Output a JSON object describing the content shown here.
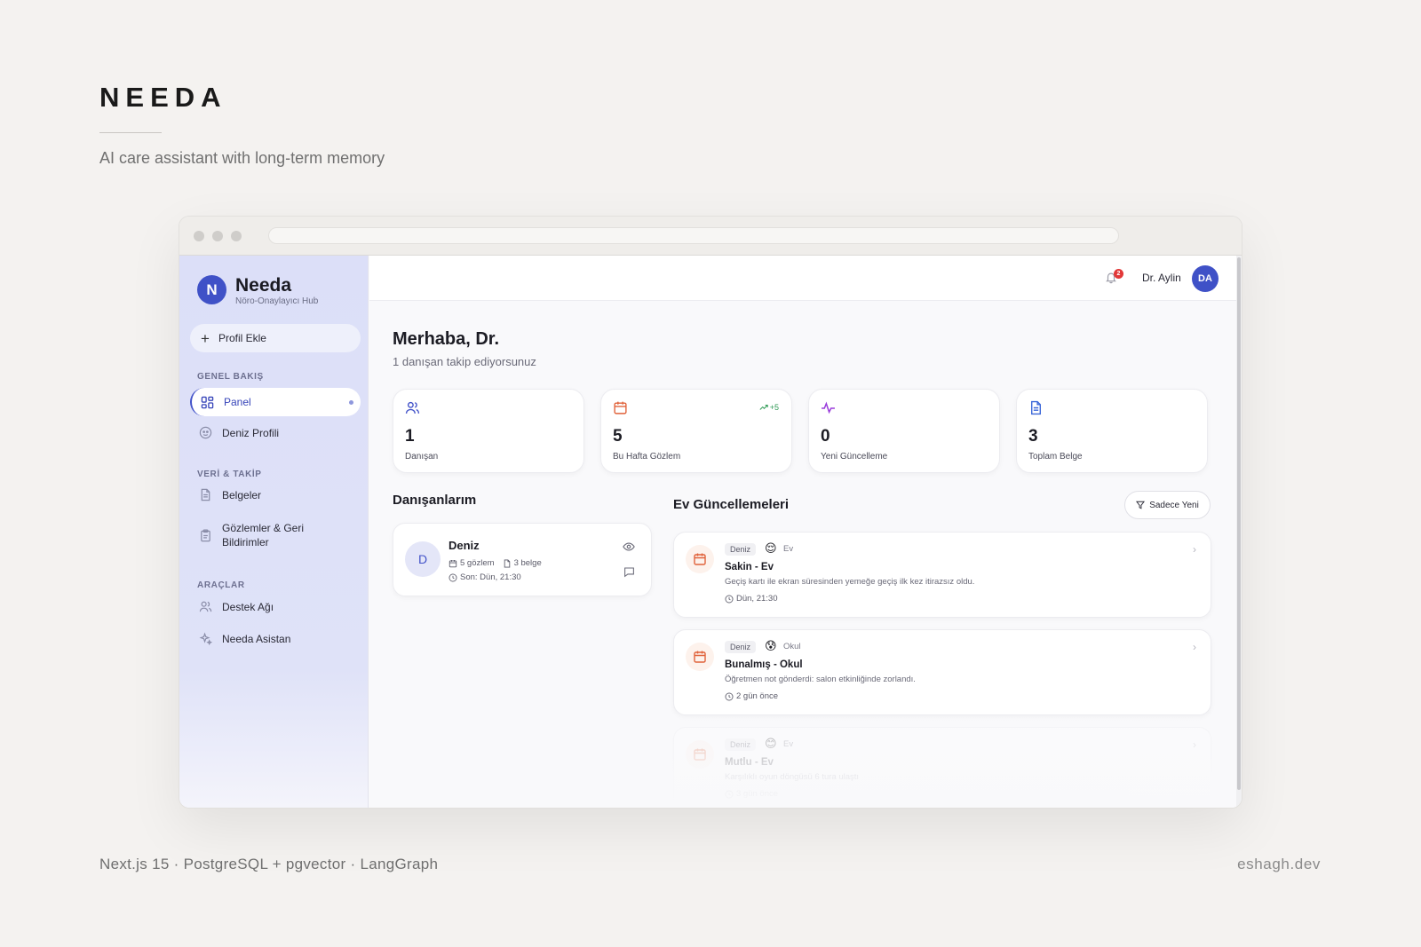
{
  "showcase": {
    "title": "NEEDA",
    "subtitle": "AI care assistant with long-term memory",
    "stack": "Next.js 15 · PostgreSQL + pgvector · LangGraph",
    "site": "eshagh.dev"
  },
  "sidebar": {
    "logo_letter": "N",
    "app_name": "Needa",
    "tagline": "Nöro-Onaylayıcı Hub",
    "add_profile": "Profil Ekle",
    "sections": {
      "overview": "GENEL BAKIŞ",
      "data": "VERİ & TAKİP",
      "tools": "ARAÇLAR"
    },
    "items": {
      "panel": "Panel",
      "profile": "Deniz Profili",
      "documents": "Belgeler",
      "observations": "Gözlemler & Geri Bildirimler",
      "support": "Destek Ağı",
      "assistant": "Needa Asistan"
    }
  },
  "topbar": {
    "notification_count": "2",
    "user_name": "Dr. Aylin",
    "user_initials": "DA"
  },
  "main": {
    "greeting": "Merhaba, Dr.",
    "greeting_sub": "1 danışan takip ediyorsunuz",
    "stats": [
      {
        "value": "1",
        "label": "Danışan",
        "icon": "users-icon",
        "color": "#4353c9"
      },
      {
        "value": "5",
        "label": "Bu Hafta Gözlem",
        "icon": "calendar-icon",
        "color": "#e0623a",
        "trend": "+5"
      },
      {
        "value": "0",
        "label": "Yeni Güncelleme",
        "icon": "activity-icon",
        "color": "#9a3ddb"
      },
      {
        "value": "3",
        "label": "Toplam Belge",
        "icon": "document-icon",
        "color": "#3a66d8"
      }
    ],
    "clients_title": "Danışanlarım",
    "client": {
      "initial": "D",
      "name": "Deniz",
      "observations": "5 gözlem",
      "documents": "3 belge",
      "last": "Son: Dün, 21:30"
    },
    "updates_title": "Ev Güncellemeleri",
    "filter_label": "Sadece Yeni",
    "updates": [
      {
        "client": "Deniz",
        "emoji": "😌",
        "place": "Ev",
        "title": "Sakin - Ev",
        "desc": "Geçiş kartı ile ekran süresinden yemeğe geçiş ilk kez itirazsız oldu.",
        "time": "Dün, 21:30"
      },
      {
        "client": "Deniz",
        "emoji": "😰",
        "place": "Okul",
        "title": "Bunalmış - Okul",
        "desc": "Öğretmen not gönderdi: salon etkinliğinde zorlandı.",
        "time": "2 gün önce"
      },
      {
        "client": "Deniz",
        "emoji": "😊",
        "place": "Ev",
        "title": "Mutlu - Ev",
        "desc": "Karşılıklı oyun döngüsü 6 tura ulaştı",
        "time": "3 gün önce"
      }
    ]
  },
  "colors": {
    "accent": "#3f51c7",
    "update_icon": "#e0623a",
    "trend": "#2f9a55",
    "alert": "#e23838"
  }
}
